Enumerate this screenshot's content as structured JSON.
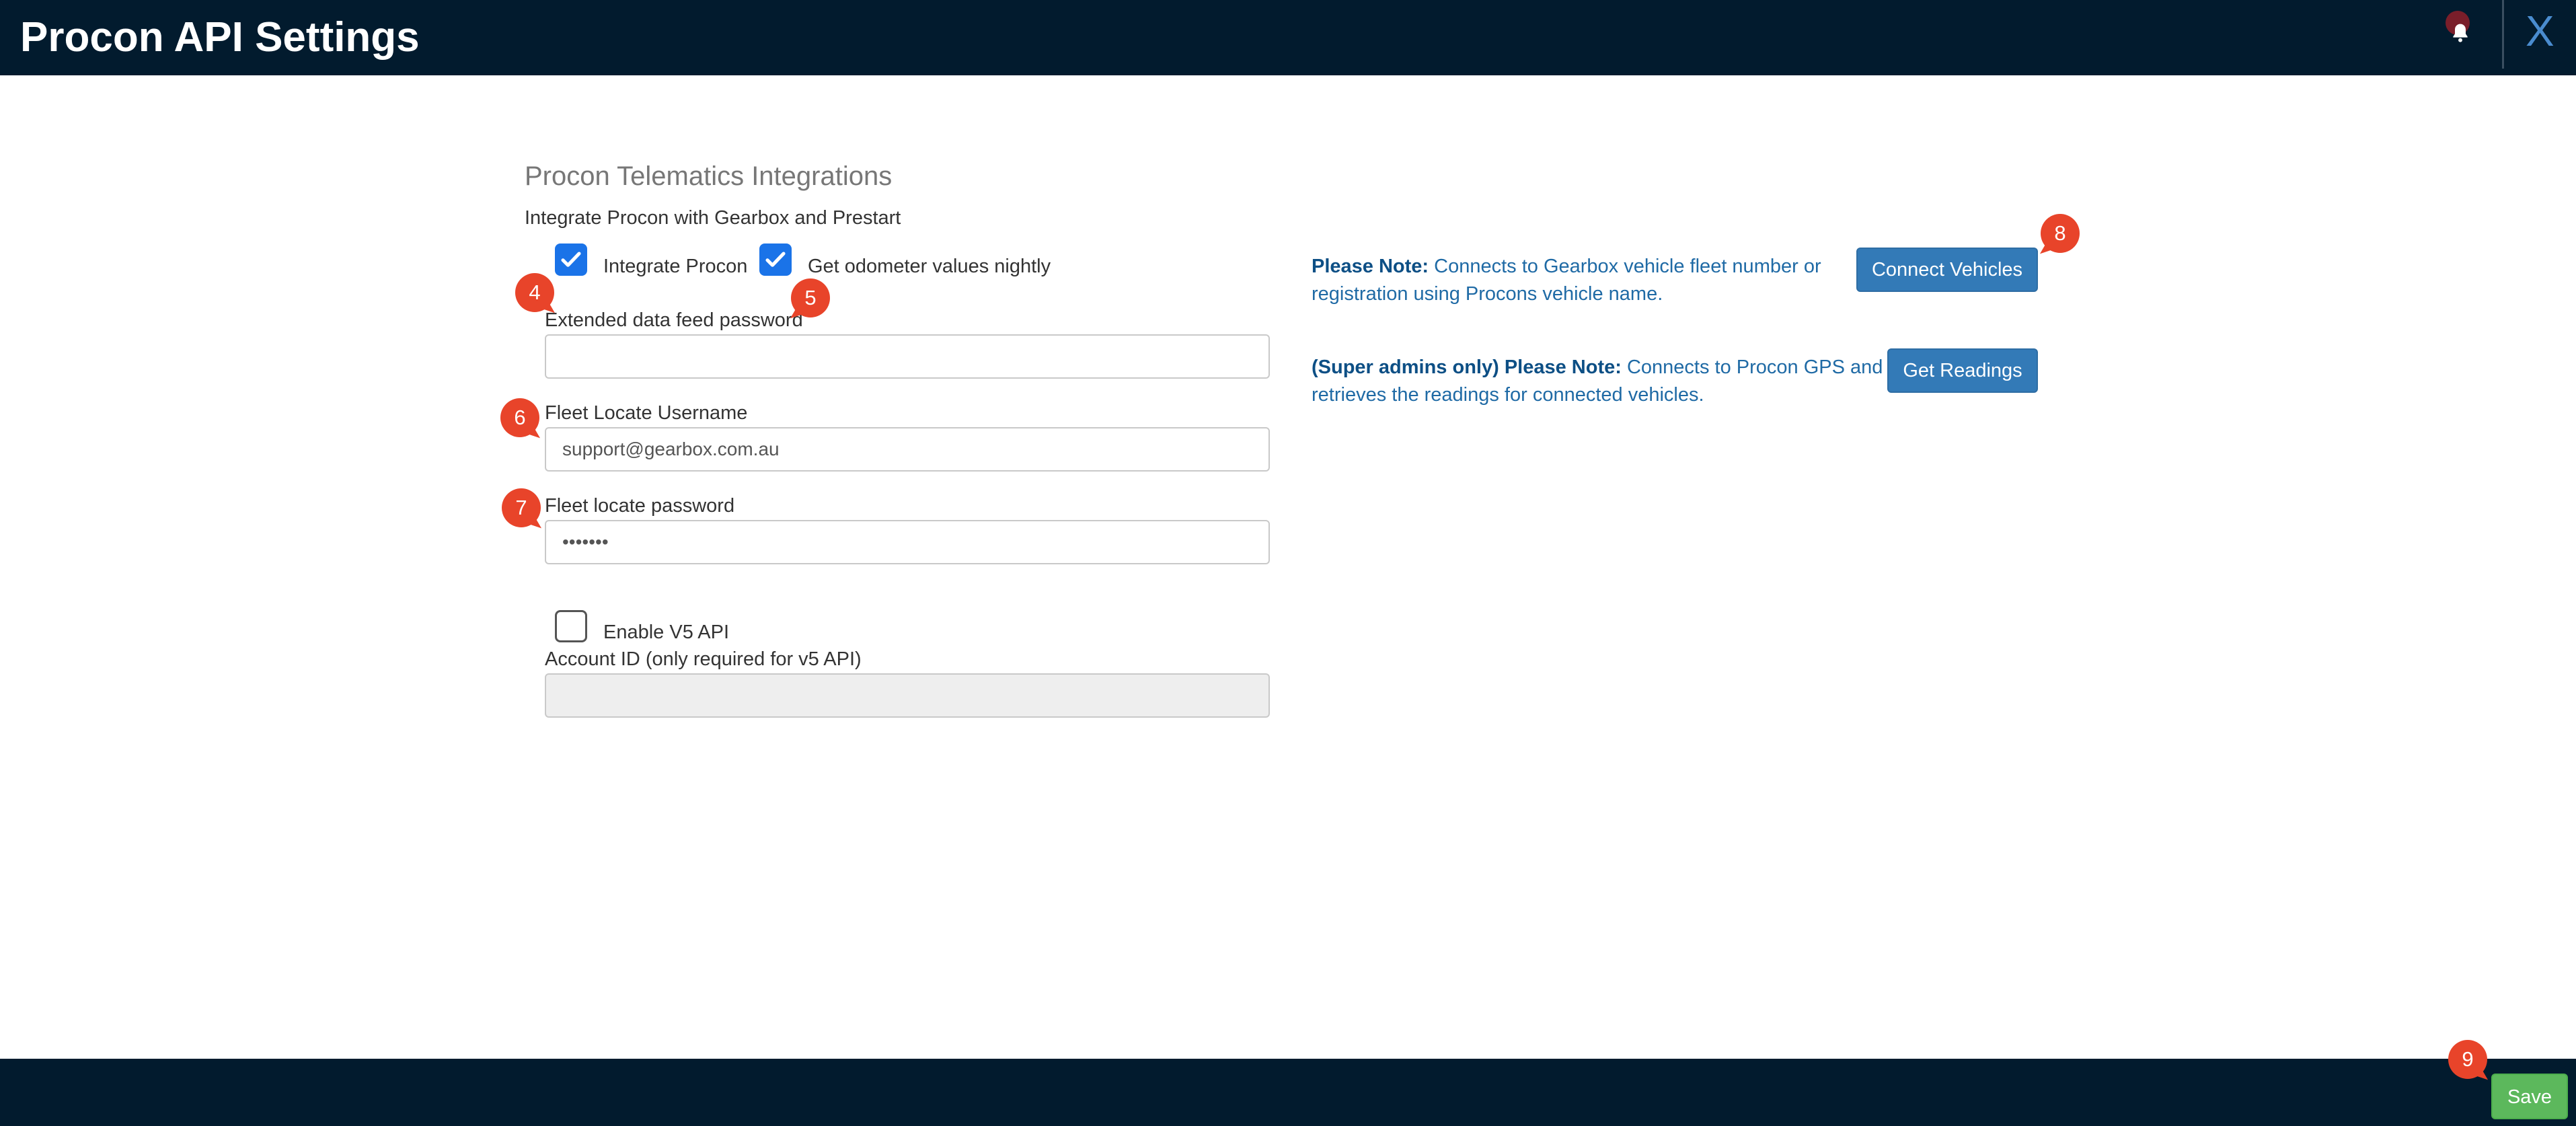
{
  "header": {
    "title": "Procon API Settings",
    "close_label": "X"
  },
  "section": {
    "title": "Procon Telematics Integrations",
    "subtitle": "Integrate Procon with Gearbox and Prestart"
  },
  "checkboxes": {
    "integrate_procon": {
      "label": "Integrate Procon",
      "checked": true
    },
    "odometer_nightly": {
      "label": "Get odometer values nightly",
      "checked": true
    },
    "enable_v5": {
      "label": "Enable V5 API",
      "checked": false
    }
  },
  "fields": {
    "extended_password": {
      "label": "Extended data feed password",
      "value": ""
    },
    "fleet_username": {
      "label": "Fleet Locate Username",
      "value": "support@gearbox.com.au"
    },
    "fleet_password": {
      "label": "Fleet locate password",
      "value": "•••••••"
    },
    "account_id": {
      "label": "Account ID (only required for v5 API)",
      "value": ""
    }
  },
  "notes": {
    "connect": {
      "bold": "Please Note:",
      "text": " Connects to Gearbox vehicle fleet number or registration using Procons vehicle name."
    },
    "readings": {
      "bold": "(Super admins only) Please Note:",
      "text": " Connects to Procon GPS and retrieves the readings for connected vehicles."
    }
  },
  "buttons": {
    "connect_vehicles": "Connect Vehicles",
    "get_readings": "Get Readings",
    "save": "Save"
  },
  "markers": [
    "4",
    "5",
    "6",
    "7",
    "8",
    "9"
  ],
  "colors": {
    "header_bg": "#021b2e",
    "checkbox_checked": "#1a73e8",
    "primary_button": "#337ab7",
    "save_button": "#5cb85c",
    "marker": "#e8442a",
    "note_text": "#1f6aa5"
  },
  "icons": {
    "bell": "bell-icon",
    "check": "checkmark-icon"
  }
}
